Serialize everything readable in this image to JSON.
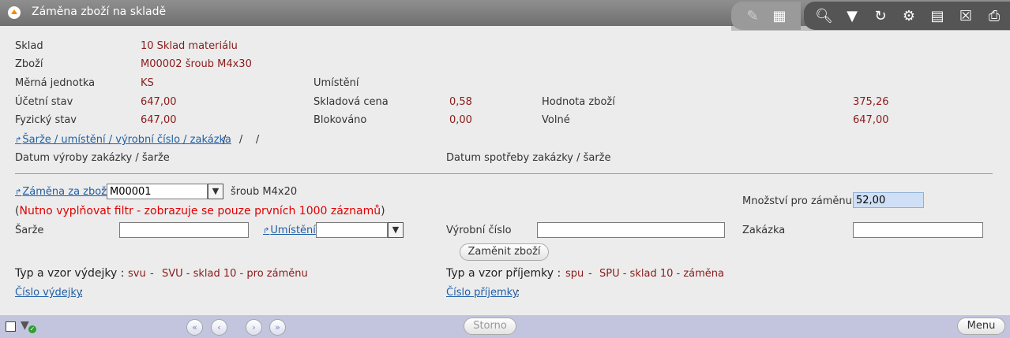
{
  "window": {
    "title": "Záměna zboží na skladě"
  },
  "toolbar": {
    "icons": [
      "edit-icon",
      "table-icon",
      "search-icon",
      "filter-icon",
      "refresh-icon",
      "user-settings-icon",
      "document-icon",
      "excel-icon",
      "print-icon"
    ]
  },
  "info": {
    "sklad_label": "Sklad",
    "sklad_value": "10  Sklad materiálu",
    "zbozi_label": "Zboží",
    "zbozi_value": "M00002  šroub M4x30",
    "mj_label": "Měrná jednotka",
    "mj_value": "KS",
    "umisteni_label": "Umístění",
    "ucetni_label": "Účetní stav",
    "ucetni_value": "647,00",
    "skladova_label": "Skladová cena",
    "skladova_value": "0,58",
    "hodnota_label": "Hodnota zboží",
    "hodnota_value": "375,26",
    "fyzicky_label": "Fyzický stav",
    "fyzicky_value": "647,00",
    "blokovano_label": "Blokováno",
    "blokovano_value": "0,00",
    "volne_label": "Volné",
    "volne_value": "647,00",
    "sarze_link": "Šarže / umístění / výrobní číslo / zakázka",
    "sarze_values": "/    /    /",
    "datum_vyroby_label": "Datum výroby zakázky / šarže",
    "datum_spotreby_label": "Datum spotřeby zakázky / šarže"
  },
  "form": {
    "zamena_link": "Záměna za zboží",
    "zamena_colon": ":",
    "zamena_value": "M00001",
    "zamena_name": "šroub M4x20",
    "warning_open": "(",
    "warning_text": "Nutno vyplňovat filtr - zobrazuje se pouze prvních 1000 záznamů",
    "warning_close": ")",
    "mnozstvi_label": "Množství pro záměnu",
    "mnozstvi_value": "52,00",
    "sarze_label": "Šarže",
    "sarze_value": "",
    "umisteni_link": "Umístění",
    "umisteni_value": "",
    "vyrobni_label": "Výrobní číslo",
    "vyrobni_value": "",
    "zakazka_label": "Zakázka",
    "zakazka_value": "",
    "submit_label": "Zaměnit zboží",
    "vydejka_label": "Typ a vzor výdejky :",
    "vydejka_code": "svu",
    "vydejka_dash": "-",
    "vydejka_name": "SVU - sklad 10 - pro záměnu",
    "prijemka_label": "Typ a vzor příjemky :",
    "prijemka_code": "spu",
    "prijemka_dash": "-",
    "prijemka_name": "SPU - sklad 10 - záměna",
    "cislo_vydejky_link": "Číslo výdejky",
    "cislo_prijemky_link": "Číslo příjemky",
    "colon": ":"
  },
  "statusbar": {
    "nav_first": "«",
    "nav_prev": "‹",
    "nav_next": "›",
    "nav_last": "»",
    "storno_label": "Storno",
    "menu_label": "Menu"
  }
}
